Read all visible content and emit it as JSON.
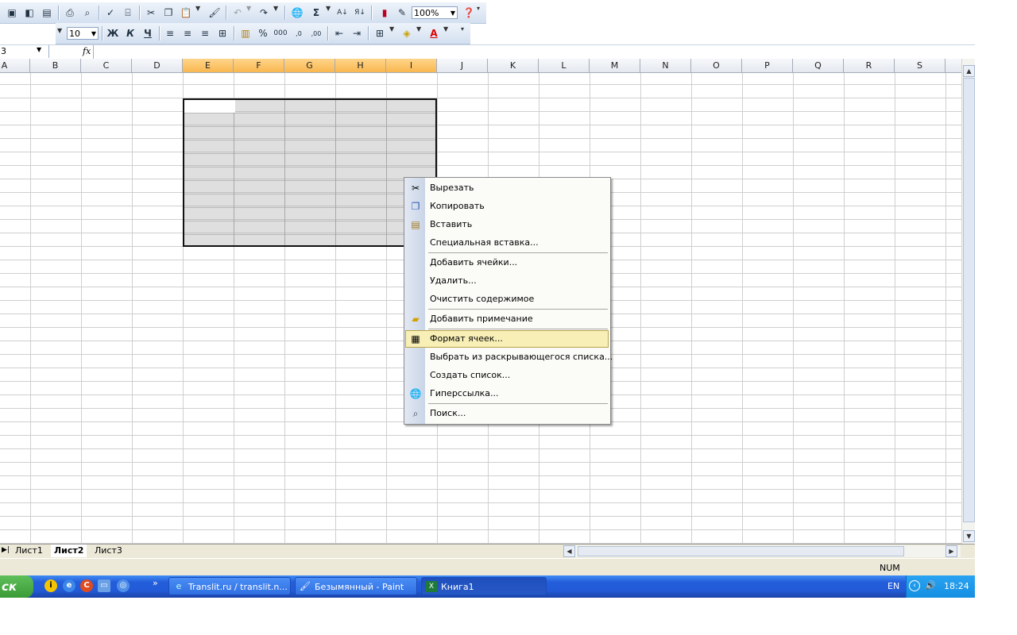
{
  "toolbar_standard": {
    "zoom_value": "100%",
    "sum_symbol": "Σ",
    "icons": [
      "save-icon",
      "permission-icon",
      "print-preview-icon",
      "print-icon",
      "preview-icon",
      "spelling-icon",
      "research-icon",
      "cut-icon",
      "copy-icon",
      "paste-icon",
      "format-painter-icon",
      "undo-icon",
      "redo-icon",
      "hyperlink-icon",
      "autosum-icon",
      "sort-ascending-icon",
      "sort-descending-icon",
      "chart-wizard-icon",
      "drawing-icon",
      "help-icon"
    ]
  },
  "toolbar_formatting": {
    "font_size": "10",
    "bold_label": "Ж",
    "italic_label": "К",
    "underline_label": "Ч",
    "percent_label": "%",
    "thousands_label": "000"
  },
  "formula_bar": {
    "name_box": "3",
    "fx_label": "fx"
  },
  "columns": [
    "A",
    "B",
    "C",
    "D",
    "E",
    "F",
    "G",
    "H",
    "I",
    "J",
    "K",
    "L",
    "M",
    "N",
    "O",
    "P",
    "Q",
    "R",
    "S"
  ],
  "selected_columns": [
    "E",
    "F",
    "G",
    "H",
    "I"
  ],
  "sheet_tabs": [
    "Лист1",
    "Лист2",
    "Лист3"
  ],
  "active_sheet": "Лист2",
  "status": {
    "num": "NUM"
  },
  "context_menu": {
    "items": [
      {
        "label": "Вырезать",
        "icon": "cut-icon"
      },
      {
        "label": "Копировать",
        "icon": "copy-icon"
      },
      {
        "label": "Вставить",
        "icon": "paste-icon"
      },
      {
        "label": "Специальная вставка...",
        "icon": ""
      },
      {
        "label": "Добавить ячейки...",
        "icon": ""
      },
      {
        "label": "Удалить...",
        "icon": ""
      },
      {
        "label": "Очистить содержимое",
        "icon": ""
      },
      {
        "label": "Добавить примечание",
        "icon": "comment-icon"
      },
      {
        "label": "Формат ячеек...",
        "icon": "format-cells-icon",
        "highlighted": true
      },
      {
        "label": "Выбрать из раскрывающегося списка...",
        "icon": ""
      },
      {
        "label": "Создать список...",
        "icon": ""
      },
      {
        "label": "Гиперссылка...",
        "icon": "hyperlink-icon"
      },
      {
        "label": "Поиск...",
        "icon": "research-icon"
      }
    ]
  },
  "taskbar": {
    "start_label": "ск",
    "quick_launch_more": "»",
    "tasks": [
      {
        "label": "Translit.ru / translit.n..."
      },
      {
        "label": "Безымянный - Paint"
      },
      {
        "label": "Книга1",
        "active": true
      }
    ],
    "language": "EN",
    "clock": "18:24"
  }
}
